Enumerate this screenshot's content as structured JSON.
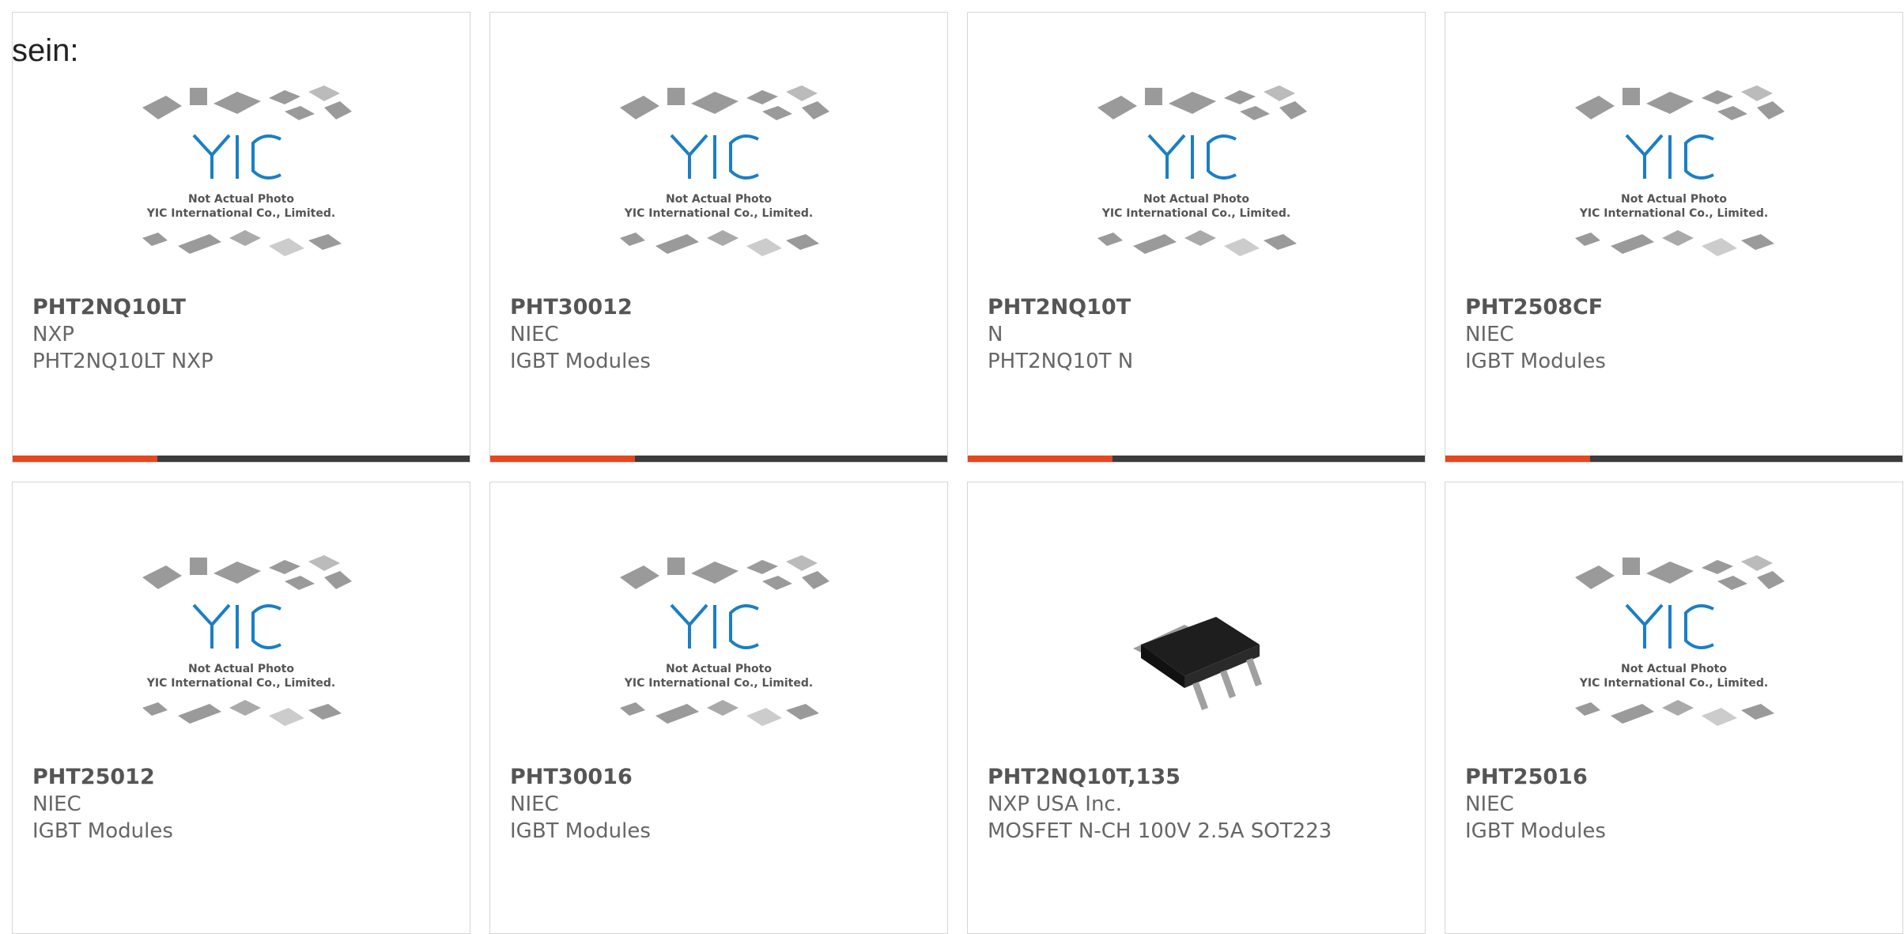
{
  "lead_text": "sein:",
  "placeholder_photo": {
    "line1": "Not Actual Photo",
    "line2": "YIC International Co., Limited."
  },
  "products": [
    {
      "part": "PHT2NQ10LT",
      "manufacturer": "NXP",
      "description": "PHT2NQ10LT NXP",
      "image": "yic-placeholder-icon"
    },
    {
      "part": "PHT30012",
      "manufacturer": "NIEC",
      "description": "IGBT Modules",
      "image": "yic-placeholder-icon"
    },
    {
      "part": "PHT2NQ10T",
      "manufacturer": "N",
      "description": "PHT2NQ10T N",
      "image": "yic-placeholder-icon"
    },
    {
      "part": "PHT2508CF",
      "manufacturer": "NIEC",
      "description": "IGBT Modules",
      "image": "yic-placeholder-icon"
    },
    {
      "part": "PHT25012",
      "manufacturer": "NIEC",
      "description": "IGBT Modules",
      "image": "yic-placeholder-icon"
    },
    {
      "part": "PHT30016",
      "manufacturer": "NIEC",
      "description": "IGBT Modules",
      "image": "yic-placeholder-icon"
    },
    {
      "part": "PHT2NQ10T,135",
      "manufacturer": "NXP USA Inc.",
      "description": "MOSFET N-CH 100V 2.5A SOT223",
      "image": "sot223-chip-photo"
    },
    {
      "part": "PHT25016",
      "manufacturer": "NIEC",
      "description": "IGBT Modules",
      "image": "yic-placeholder-icon"
    }
  ],
  "colors": {
    "accent": "#e8461e",
    "bar": "#3c3c3c",
    "logo": "#1a7fc4"
  }
}
